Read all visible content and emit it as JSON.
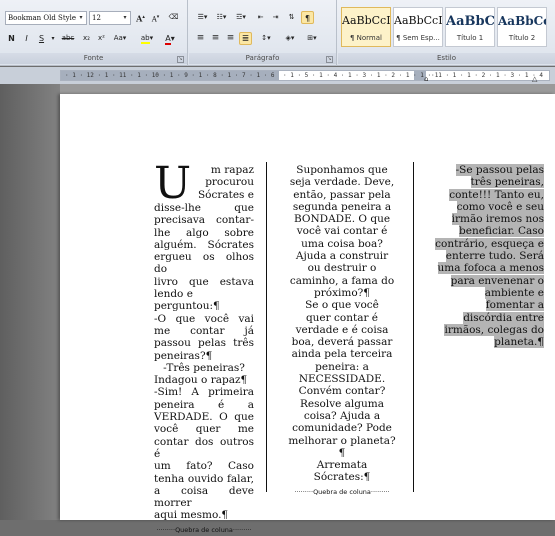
{
  "ribbon": {
    "font_group": {
      "label": "Fonte",
      "font_name": "Bookman Old Style",
      "font_size": "12",
      "grow_label": "A",
      "shrink_label": "A",
      "bold": "N",
      "italic": "I",
      "underline": "S",
      "strike": "abc",
      "subscript": "x₂",
      "superscript": "x²",
      "change_case": "Aa",
      "highlight": "ab",
      "font_color": "A"
    },
    "paragraph_group": {
      "label": "Parágrafo",
      "pilcrow": "¶"
    },
    "styles_group": {
      "label": "Estilo",
      "styles": [
        {
          "sample": "AaBbCcI",
          "name": "¶ Normal",
          "selected": true
        },
        {
          "sample": "AaBbCcI",
          "name": "¶ Sem Esp...",
          "selected": false
        },
        {
          "sample": "AaBbC",
          "name": "Título 1",
          "selected": false
        },
        {
          "sample": "AaBbCc",
          "name": "Título 2",
          "selected": false
        }
      ]
    }
  },
  "ruler": {
    "left_numbers": "· 1 · 12 · 1 · 11 · 1 · 10 · 1 · 9 · 1 · 8 · 1 · 7 · 1 · 6",
    "mid_numbers": "· 1 · 5 · 1 · 4 · 1 · 3 · 1 · 2 · 1 · 1 · 1",
    "right_numbers": "· 1 · 1 · 1 · 2 · 1 · 3 · 1 · 4"
  },
  "document": {
    "col1": {
      "drop_cap": "U",
      "lines_top": [
        "m rapaz",
        "procurou",
        "Sócrates e"
      ],
      "lines": [
        "disse-lhe que",
        "precisava contar-",
        "lhe algo sobre",
        "alguém. Sócrates",
        "ergueu os olhos do",
        "livro que estava",
        "lendo e perguntou:¶",
        "-O que você vai",
        "me contar já",
        "passou pelas três",
        "peneiras?¶",
        "-Três peneiras?",
        "Indagou o rapaz¶",
        "-Sim! A primeira",
        "peneira é a",
        "VERDADE. O que",
        "você quer me",
        "contar dos outros é",
        "um fato? Caso",
        "tenha ouvido falar,",
        "a coisa deve morrer",
        "aqui mesmo.¶"
      ],
      "column_break": "Quebra de coluna"
    },
    "col2": {
      "lines": [
        "Suponhamos que",
        "seja verdade. Deve,",
        "então, passar pela",
        "segunda peneira a",
        "BONDADE. O que",
        "você vai contar é",
        "uma coisa boa?",
        "Ajuda a construir",
        "ou destruir o",
        "caminho, a fama do",
        "próximo?¶",
        "Se o que você",
        "quer contar é",
        "verdade e é coisa",
        "boa, deverá passar",
        "ainda pela terceira",
        "peneira: a",
        "NECESSIDADE.",
        "Convém contar?",
        "Resolve alguma",
        "coisa? Ajuda a",
        "comunidade? Pode",
        "melhorar o planeta?¶",
        "Arremata",
        "Sócrates:¶"
      ],
      "column_break": "Quebra de coluna"
    },
    "col3": {
      "lines": [
        "-Se passou pelas",
        "três peneiras,",
        "conte!!! Tanto eu,",
        "como você e seu",
        "irmão iremos nos",
        "beneficiar. Caso",
        "contrário, esqueça e",
        "enterre tudo. Será",
        "uma fofoca a menos",
        "para envenenar o",
        "ambiente e",
        "fomentar a",
        "discórdia entre",
        "irmãos, colegas do",
        "planeta.¶"
      ]
    }
  }
}
